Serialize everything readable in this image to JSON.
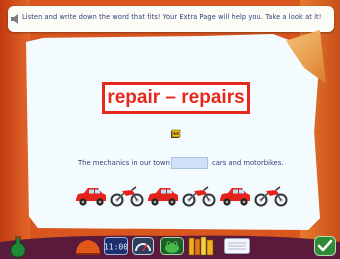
{
  "instruction": {
    "text": "Listen and write down the word that fits! Your Extra Page will help you. Take a look at it!"
  },
  "word_card": {
    "text": "repair – repairs"
  },
  "sentence": {
    "before": "The mechanics in our town",
    "after": "cars and motorbikes.",
    "answer_value": ""
  },
  "vehicles": [
    "car",
    "motorbike",
    "car",
    "motorbike",
    "car",
    "motorbike"
  ],
  "toolbar": {
    "clock_text": "11:00"
  },
  "colors": {
    "accent_red": "#e5271c",
    "text_blue": "#2f3d7b",
    "input_blue": "#cfe0f8",
    "background_orange": "#d9561f"
  },
  "icons": [
    "speaker-icon",
    "audio-icon",
    "car-icon",
    "motorbike-icon",
    "potion-icon",
    "cap-icon",
    "clock-icon",
    "gauge-icon",
    "frog-icon",
    "dictionary-icon",
    "notepad-icon",
    "check-icon"
  ]
}
